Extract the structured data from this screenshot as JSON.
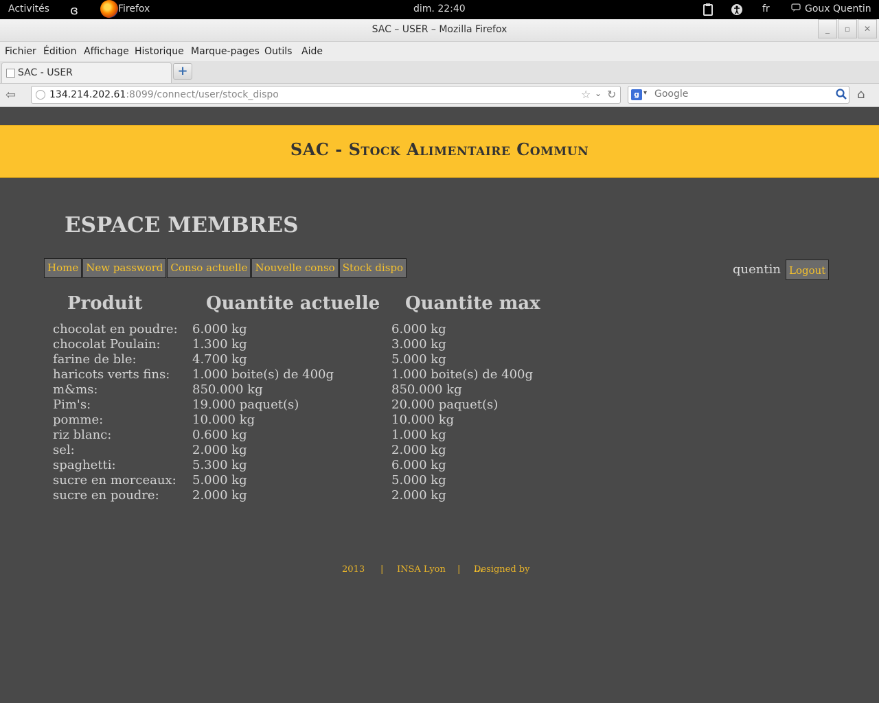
{
  "system_bar": {
    "activities": "Activités",
    "app_name": "Firefox",
    "clock": "dim. 22:40",
    "language": "fr",
    "user": "Goux Quentin"
  },
  "window": {
    "title": "SAC – USER – Mozilla Firefox"
  },
  "menu": [
    "Fichier",
    "Édition",
    "Affichage",
    "Historique",
    "Marque-pages",
    "Outils",
    "Aide"
  ],
  "tab": {
    "title": "SAC - USER"
  },
  "urlbar": {
    "host": "134.214.202.61",
    "rest": ":8099/connect/user/stock_dispo"
  },
  "search": {
    "placeholder": "Google",
    "engine_letter": "g"
  },
  "page": {
    "site_title": "SAC - Stock Alimentaire Commun",
    "section_heading": "ESPACE MEMBRES",
    "nav": [
      "Home",
      "New password",
      "Conso actuelle",
      "Nouvelle conso",
      "Stock dispo"
    ],
    "username": "quentin",
    "logout": "Logout",
    "table": {
      "headers": [
        "Produit",
        "Quantite actuelle",
        "Quantite max"
      ],
      "rows": [
        [
          "chocolat en poudre:",
          "6.000 kg",
          "6.000 kg"
        ],
        [
          "chocolat Poulain:",
          "1.300 kg",
          "3.000 kg"
        ],
        [
          "farine de ble:",
          "4.700 kg",
          "5.000 kg"
        ],
        [
          "haricots verts fins:",
          "1.000 boite(s) de 400g",
          "1.000 boite(s) de 400g"
        ],
        [
          "m&ms:",
          "850.000 kg",
          "850.000 kg"
        ],
        [
          "Pim's:",
          "19.000 paquet(s)",
          "20.000 paquet(s)"
        ],
        [
          "pomme:",
          "10.000 kg",
          "10.000 kg"
        ],
        [
          "riz blanc:",
          "0.600 kg",
          "1.000 kg"
        ],
        [
          "sel:",
          "2.000 kg",
          "2.000 kg"
        ],
        [
          "spaghetti:",
          "5.300 kg",
          "6.000 kg"
        ],
        [
          "sucre en morceaux:",
          "5.000 kg",
          "5.000 kg"
        ],
        [
          "sucre en poudre:",
          "2.000 kg",
          "2.000 kg"
        ]
      ]
    },
    "footer": {
      "year": "2013",
      "separator": "|",
      "org": "INSA Lyon",
      "designed": "Designed by",
      "designer": "..."
    }
  },
  "colors": {
    "banner": "#fcc22c",
    "page_bg": "#494949",
    "nav_text": "#f6c22c",
    "nav_bg": "#6b6b6b"
  },
  "icons": {
    "gnome": "gnome-foot-icon",
    "firefox": "firefox-logo-icon",
    "clipboard": "clipboard-icon",
    "accessibility": "accessibility-icon",
    "chat": "chat-icon",
    "back": "back-arrow-icon",
    "globe": "globe-icon",
    "star": "bookmark-star-icon",
    "reload": "reload-icon",
    "search": "search-icon",
    "home": "home-icon"
  }
}
